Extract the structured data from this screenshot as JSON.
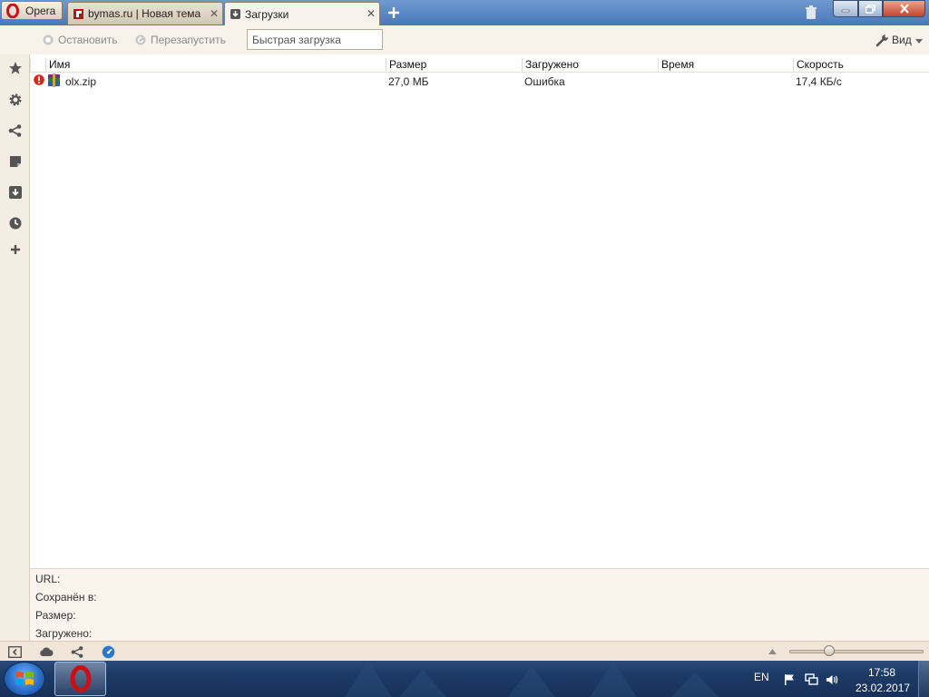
{
  "titlebar": {
    "menu_label": "Opera",
    "tabs": [
      {
        "title": "bymas.ru | Новая тема",
        "close": "✕"
      },
      {
        "title": "Загрузки",
        "close": "✕"
      }
    ]
  },
  "toolbar": {
    "stop_label": "Остановить",
    "restart_label": "Перезапустить",
    "quick_download_placeholder": "Быстрая загрузка",
    "view_label": "Вид"
  },
  "list": {
    "columns": [
      "Имя",
      "Размер",
      "Загружено",
      "Время",
      "Скорость"
    ],
    "rows": [
      {
        "name": "olx.zip",
        "size": "27,0 МБ",
        "status": "Ошибка",
        "time": "",
        "speed": "17,4 КБ/с"
      }
    ]
  },
  "details": {
    "url_label": "URL:",
    "saved_label": "Сохранён в:",
    "size_label": "Размер:",
    "loaded_label": "Загружено:"
  },
  "statusbar": {
    "zoom_level": 0.28
  },
  "taskbar": {
    "lang": "EN",
    "time": "17:58",
    "date": "23.02.2017"
  },
  "colors": {
    "opera_red": "#cc0f16",
    "error_red": "#d32b1e"
  }
}
